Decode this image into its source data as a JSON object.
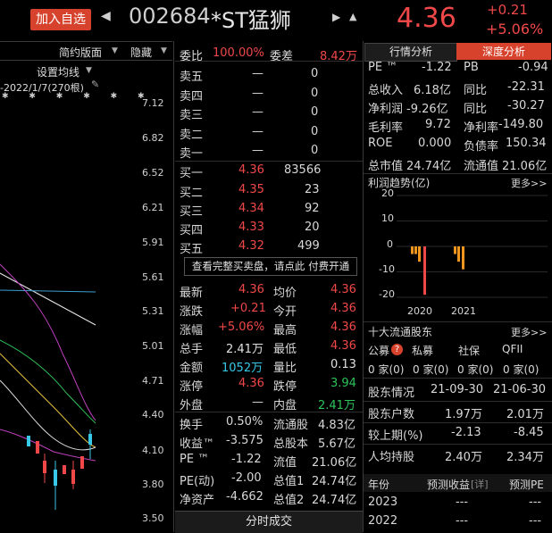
{
  "header": {
    "add_watchlist": "加入自选",
    "prev_icon": "◀",
    "code": "002684",
    "name": "*ST猛狮",
    "next_icon": "▶",
    "bell_icon": "▲",
    "price": "4.36",
    "change": "+0.21",
    "change_pct": "+5.06%"
  },
  "chart": {
    "tab_simple": "简约版面",
    "tab_hide": "隐藏",
    "setting_ma": "设置均线",
    "date_label": "-2022/1/7(270根)",
    "markers": "✱ ✱ ✱ ✱ ✱ ✱",
    "y_ticks": [
      "7.12",
      "6.82",
      "6.52",
      "6.21",
      "5.91",
      "5.61",
      "5.31",
      "5.01",
      "4.71",
      "4.40",
      "4.10",
      "3.80",
      "3.50"
    ]
  },
  "orderbook": {
    "ratio_label": "委比",
    "ratio_value": "100.00%",
    "diff_label": "委差",
    "diff_value": "8.42万",
    "asks": [
      {
        "label": "卖五",
        "price": "—",
        "vol": "0"
      },
      {
        "label": "卖四",
        "price": "—",
        "vol": "0"
      },
      {
        "label": "卖三",
        "price": "—",
        "vol": "0"
      },
      {
        "label": "卖二",
        "price": "—",
        "vol": "0"
      },
      {
        "label": "卖一",
        "price": "—",
        "vol": "0"
      }
    ],
    "bids": [
      {
        "label": "买一",
        "price": "4.36",
        "vol": "83566"
      },
      {
        "label": "买二",
        "price": "4.35",
        "vol": "23"
      },
      {
        "label": "买三",
        "price": "4.34",
        "vol": "92"
      },
      {
        "label": "买四",
        "price": "4.33",
        "vol": "20"
      },
      {
        "label": "买五",
        "price": "4.32",
        "vol": "499"
      }
    ],
    "full_book": "查看完整买卖盘，请点此 付费开通"
  },
  "quote": {
    "rows": [
      {
        "l1": "最新",
        "v1": "4.36",
        "l2": "均价",
        "v2": "4.36"
      },
      {
        "l1": "涨跌",
        "v1": "+0.21",
        "l2": "今开",
        "v2": "4.36"
      },
      {
        "l1": "涨幅",
        "v1": "+5.06%",
        "l2": "最高",
        "v2": "4.36"
      },
      {
        "l1": "总手",
        "v1": "2.41万",
        "l2": "最低",
        "v2": "4.36"
      },
      {
        "l1": "金额",
        "v1": "1052万",
        "l2": "量比",
        "v2": "0.13"
      },
      {
        "l1": "涨停",
        "v1": "4.36",
        "l2": "跌停",
        "v2": "3.94"
      },
      {
        "l1": "外盘",
        "v1": "—",
        "l2": "内盘",
        "v2": "2.41万"
      }
    ],
    "rows2": [
      {
        "l1": "换手",
        "v1": "0.50%",
        "l2": "流通股",
        "v2": "4.83亿"
      },
      {
        "l1": "收益™",
        "v1": "-3.575",
        "l2": "总股本",
        "v2": "5.67亿"
      },
      {
        "l1": "PE ™",
        "v1": "-1.22",
        "l2": "流值",
        "v2": "21.06亿"
      },
      {
        "l1": "PE(动)",
        "v1": "-2.00",
        "l2": "总值1",
        "v2": "24.74亿"
      },
      {
        "l1": "净资产",
        "v1": "-4.662",
        "l2": "总值2",
        "v2": "24.74亿"
      }
    ],
    "bottom_tab": "分时成交"
  },
  "deep": {
    "tab_quote": "行情分析",
    "tab_deep": "深度分析",
    "fin": [
      {
        "l1": "PE ™",
        "v1": "-1.22",
        "l2": "PB",
        "v2": "-0.94"
      },
      {
        "l1": "总收入",
        "v1": "6.18亿",
        "l2": "同比",
        "v2": "-22.31"
      },
      {
        "l1": "净利润",
        "v1": "-9.26亿",
        "l2": "同比",
        "v2": "-30.27"
      },
      {
        "l1": "毛利率",
        "v1": "9.72",
        "l2": "净利率",
        "v2": "-149.80"
      },
      {
        "l1": "ROE",
        "v1": "0.000",
        "l2": "负债率",
        "v2": "150.34"
      },
      {
        "l1": "总市值",
        "v1": "24.74亿",
        "l2": "流通值",
        "v2": "21.06亿"
      }
    ],
    "profit_title": "利润趋势(亿)",
    "more": "更多>>",
    "profit_y": [
      "20",
      "10",
      "0",
      "-10",
      "-20"
    ],
    "profit_x": [
      "2020",
      "2021"
    ],
    "holders_title": "十大流通股东",
    "holder_types": [
      "公募",
      "私募",
      "社保",
      "QFII"
    ],
    "holder_counts": [
      "0 家(0)",
      "0 家(0)",
      "0 家(0)",
      "0 家(0)"
    ],
    "holder_rows": [
      {
        "label": "股东情况",
        "a": "21-09-30",
        "b": "21-06-30"
      },
      {
        "label": "股东户数",
        "a": "1.97万",
        "b": "2.01万"
      },
      {
        "label": "较上期(%)",
        "a": "-2.13",
        "b": "-8.45"
      },
      {
        "label": "人均持股",
        "a": "2.40万",
        "b": "2.34万"
      }
    ],
    "forecast_header": [
      "年份",
      "预测收益",
      "[详]",
      "预测PE"
    ],
    "forecast_rows": [
      {
        "year": "2023",
        "eps": "---",
        "pe": "---"
      },
      {
        "year": "2022",
        "eps": "---",
        "pe": "---"
      }
    ]
  }
}
